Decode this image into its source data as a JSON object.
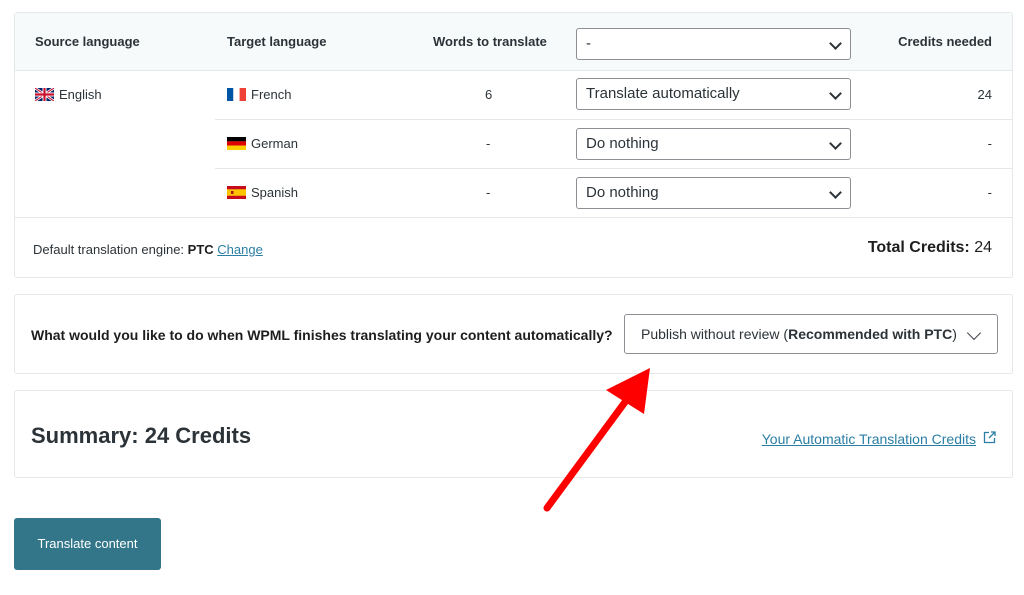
{
  "table": {
    "headers": {
      "source": "Source language",
      "target": "Target language",
      "words": "Words to translate",
      "credits": "Credits needed"
    },
    "bulk_select_value": "-",
    "source_language": {
      "name": "English",
      "flag": "uk-flag"
    },
    "rows": [
      {
        "language": "French",
        "flag": "france-flag",
        "words": "6",
        "action": "Translate automatically",
        "credits": "24"
      },
      {
        "language": "German",
        "flag": "germany-flag",
        "words": "-",
        "action": "Do nothing",
        "credits": "-"
      },
      {
        "language": "Spanish",
        "flag": "spain-flag",
        "words": "-",
        "action": "Do nothing",
        "credits": "-"
      }
    ],
    "footer": {
      "engine_label": "Default translation engine:",
      "engine_value": "PTC",
      "change_link": "Change",
      "total_label": "Total Credits:",
      "total_value": "24"
    }
  },
  "review": {
    "question": "What would you like to do when WPML finishes translating your content automatically?",
    "select_value": "Publish without review",
    "select_bold": "Recommended with PTC"
  },
  "summary": {
    "title": "Summary: 24 Credits",
    "credits_link": "Your Automatic Translation Credits"
  },
  "actions": {
    "translate_button": "Translate content"
  },
  "colors": {
    "accent": "#33768a",
    "link": "#2a7ea4",
    "arrow": "#ff0000",
    "header_bg": "#f6fafb"
  }
}
